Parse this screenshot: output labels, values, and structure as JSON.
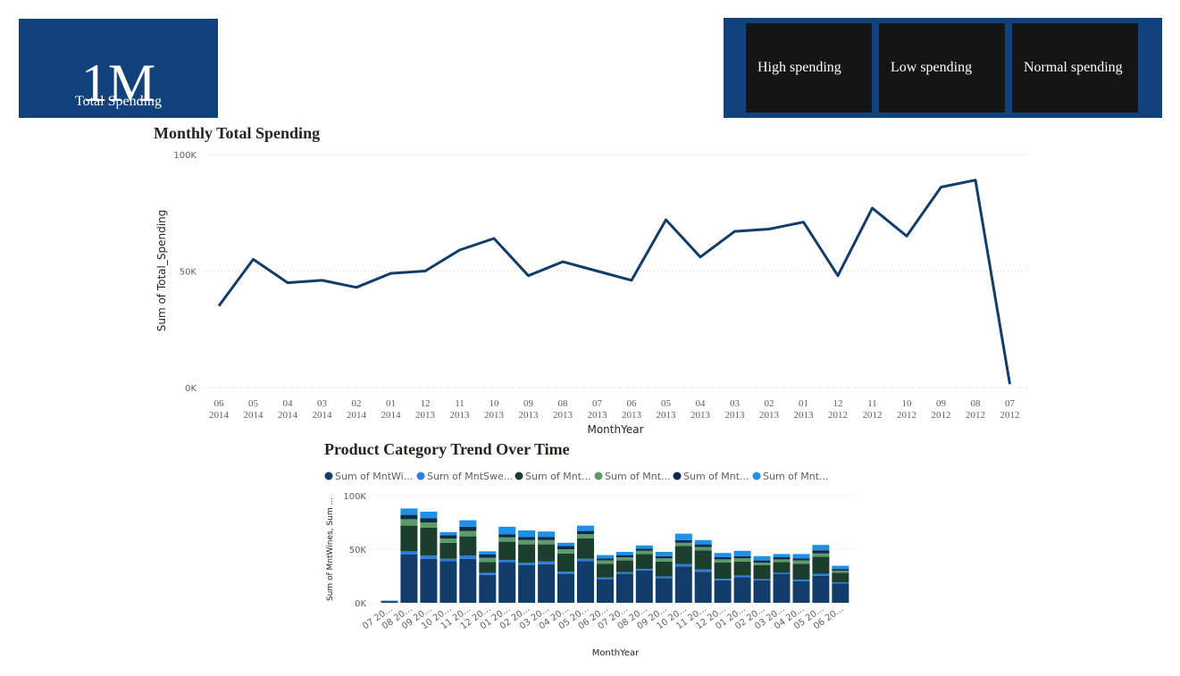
{
  "kpi": {
    "value": "1M",
    "label": "Total Spending"
  },
  "slicer": {
    "buttons": [
      "High spending",
      "Low spending",
      "Normal spending"
    ]
  },
  "colors": {
    "panel": "#11427c",
    "button": "#151515",
    "line": "#123c69"
  },
  "line_chart": {
    "title": "Monthly Total Spending",
    "xlabel": "MonthYear",
    "ylabel": "Sum of Total_Spending",
    "yticks": [
      "100K",
      "50K",
      "0K"
    ]
  },
  "bar_chart": {
    "title": "Product Category Trend Over Time",
    "xlabel": "MonthYear",
    "ylabel": "Sum of MntWines, Sum ...",
    "yticks": [
      "100K",
      "50K",
      "0K"
    ],
    "legend": [
      {
        "label": "Sum of MntWi...",
        "color": "#123c69"
      },
      {
        "label": "Sum of MntSwe...",
        "color": "#2a7fe0"
      },
      {
        "label": "Sum of Mnt...",
        "color": "#1c3e2e"
      },
      {
        "label": "Sum of Mnt...",
        "color": "#5d9c69"
      },
      {
        "label": "Sum of Mnt...",
        "color": "#0f2c4c"
      },
      {
        "label": "Sum of Mnt...",
        "color": "#1e90e8"
      }
    ],
    "xtick_labels": [
      "07 20...",
      "08 20...",
      "09 20...",
      "10 20...",
      "11 20...",
      "12 20...",
      "01 20...",
      "02 20...",
      "03 20...",
      "04 20...",
      "05 20...",
      "06 20...",
      "07 20...",
      "08 20...",
      "09 20...",
      "10 20...",
      "11 20...",
      "12 20...",
      "01 20...",
      "02 20...",
      "03 20...",
      "04 20...",
      "05 20...",
      "06 20..."
    ]
  },
  "chart_data": [
    {
      "type": "line",
      "title": "Monthly Total Spending",
      "xlabel": "MonthYear",
      "ylabel": "Sum of Total_Spending",
      "ylim": [
        0,
        100000
      ],
      "grid": true,
      "categories": [
        [
          "06",
          "2014"
        ],
        [
          "05",
          "2014"
        ],
        [
          "04",
          "2014"
        ],
        [
          "03",
          "2014"
        ],
        [
          "02",
          "2014"
        ],
        [
          "01",
          "2014"
        ],
        [
          "12",
          "2013"
        ],
        [
          "11",
          "2013"
        ],
        [
          "10",
          "2013"
        ],
        [
          "09",
          "2013"
        ],
        [
          "08",
          "2013"
        ],
        [
          "07",
          "2013"
        ],
        [
          "06",
          "2013"
        ],
        [
          "05",
          "2013"
        ],
        [
          "04",
          "2013"
        ],
        [
          "03",
          "2013"
        ],
        [
          "02",
          "2013"
        ],
        [
          "01",
          "2013"
        ],
        [
          "12",
          "2012"
        ],
        [
          "11",
          "2012"
        ],
        [
          "10",
          "2012"
        ],
        [
          "09",
          "2012"
        ],
        [
          "08",
          "2012"
        ],
        [
          "07",
          "2012"
        ]
      ],
      "series": [
        {
          "values": [
            35000,
            55000,
            45000,
            46000,
            43000,
            49000,
            50000,
            59000,
            64000,
            48000,
            54000,
            50000,
            46000,
            72000,
            56000,
            67000,
            68000,
            71000,
            48000,
            77000,
            65000,
            86000,
            89000,
            1500
          ]
        }
      ]
    },
    {
      "type": "bar",
      "title": "Product Category Trend Over Time",
      "xlabel": "MonthYear",
      "ylabel": "Sum of MntWines, Sum ...",
      "ylim": [
        0,
        100000
      ],
      "grid": true,
      "stacked": true,
      "categories": [
        "07 2012",
        "08 2012",
        "09 2012",
        "10 2012",
        "11 2012",
        "12 2012",
        "01 2013",
        "02 2013",
        "03 2013",
        "04 2013",
        "05 2013",
        "06 2013",
        "07 2013",
        "08 2013",
        "09 2013",
        "10 2013",
        "11 2013",
        "12 2013",
        "01 2014",
        "02 2014",
        "03 2014",
        "04 2014",
        "05 2014",
        "06 2014"
      ],
      "series": [
        {
          "name": "Sum of MntWi...",
          "color": "#123c69",
          "values": [
            1200,
            45000,
            41000,
            39000,
            41000,
            26000,
            38000,
            35000,
            36000,
            27000,
            39000,
            22000,
            27000,
            30000,
            23000,
            34000,
            29000,
            21000,
            24000,
            21000,
            27000,
            20000,
            25000,
            18000
          ]
        },
        {
          "name": "Sum of MntSwe...",
          "color": "#2a7fe0",
          "values": [
            100,
            3000,
            3000,
            2000,
            3000,
            2000,
            2000,
            2500,
            2500,
            2000,
            2000,
            1500,
            1500,
            1500,
            1500,
            2000,
            2000,
            1500,
            1500,
            1000,
            1000,
            1500,
            2000,
            1000
          ]
        },
        {
          "name": "Sum of Mnt...",
          "color": "#1c3e2e",
          "values": [
            300,
            24000,
            26000,
            15000,
            18000,
            10000,
            17000,
            17000,
            16000,
            17000,
            19000,
            13000,
            11000,
            14000,
            14000,
            17000,
            18000,
            15000,
            13000,
            13000,
            10000,
            15000,
            16000,
            9000
          ]
        },
        {
          "name": "Sum of Mnt...",
          "color": "#5d9c69",
          "values": [
            100,
            6000,
            5000,
            4000,
            5000,
            4000,
            4000,
            4000,
            4000,
            4000,
            4000,
            3000,
            3000,
            3000,
            3000,
            3000,
            3000,
            3000,
            3000,
            2500,
            2500,
            3000,
            3000,
            2000
          ]
        },
        {
          "name": "Sum of Mnt...",
          "color": "#0f2c4c",
          "values": [
            100,
            4000,
            4000,
            3000,
            4000,
            3000,
            3000,
            3000,
            3000,
            3000,
            3000,
            2000,
            2000,
            2000,
            2000,
            2500,
            2500,
            2000,
            2000,
            2000,
            2000,
            2000,
            3000,
            1500
          ]
        },
        {
          "name": "Sum of Mnt...",
          "color": "#1e90e8",
          "values": [
            200,
            6000,
            6000,
            3000,
            6000,
            3000,
            7000,
            6000,
            5000,
            3000,
            5000,
            3000,
            3000,
            3000,
            4000,
            6000,
            4000,
            4000,
            5000,
            4000,
            3000,
            4000,
            5000,
            3000
          ]
        }
      ]
    }
  ]
}
